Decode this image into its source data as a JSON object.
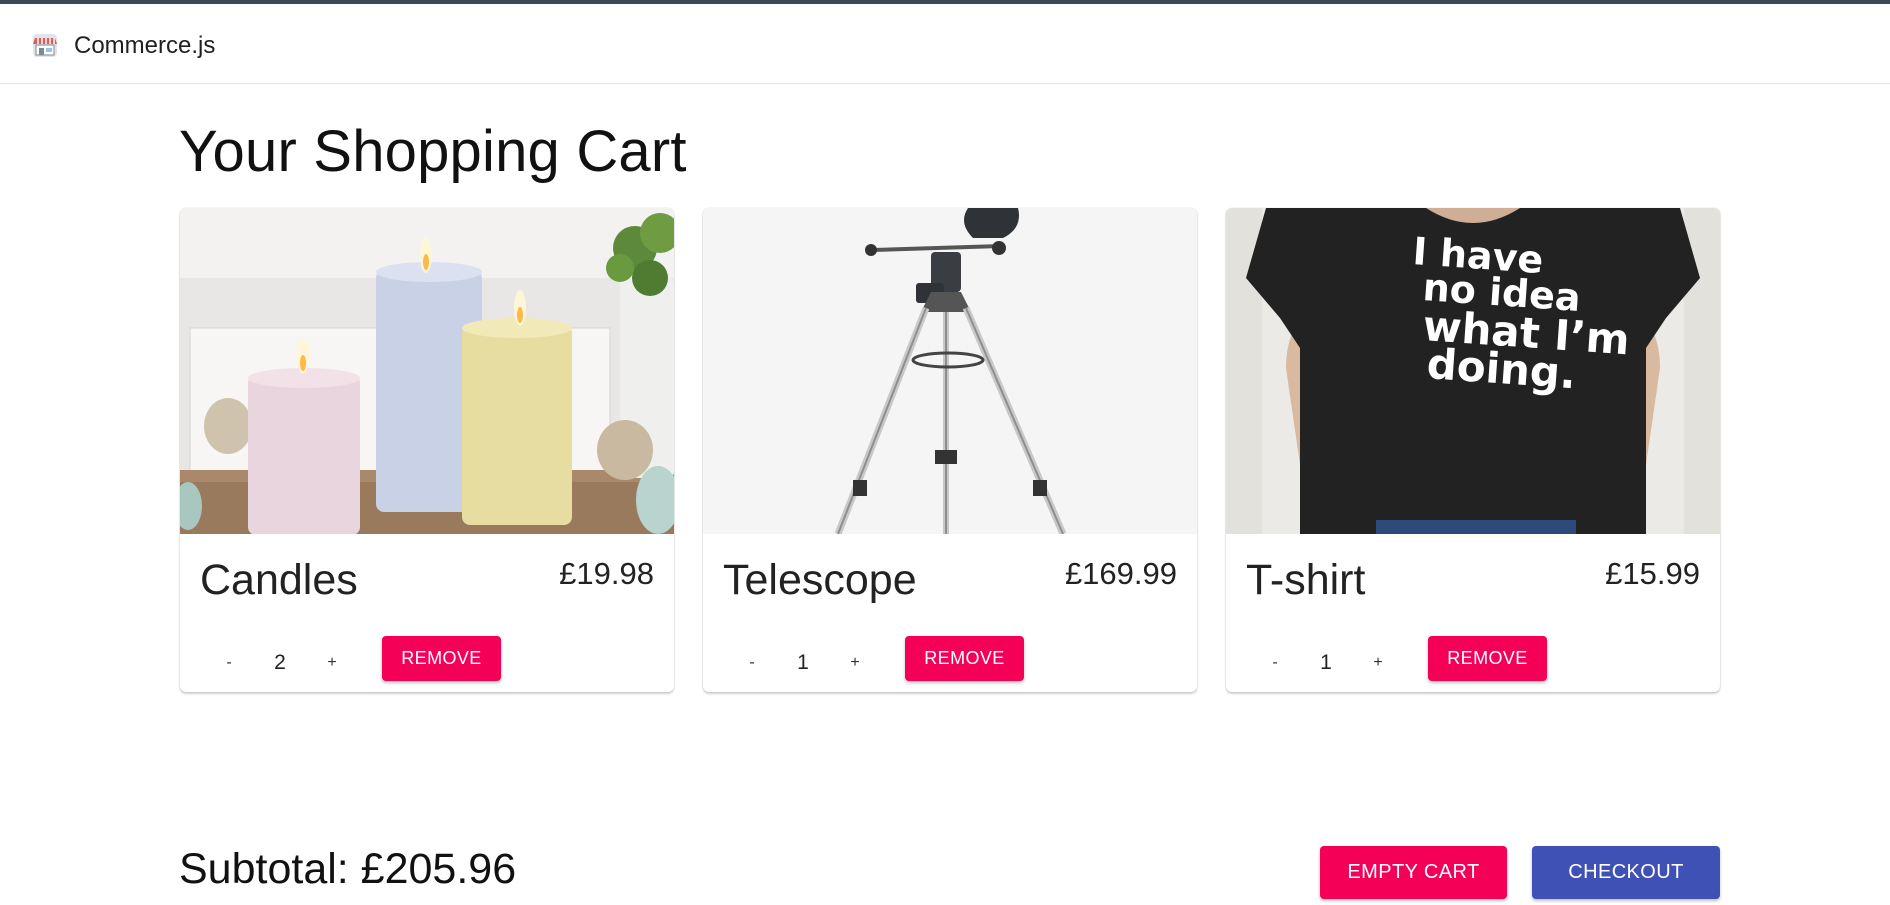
{
  "app": {
    "brand": "Commerce.js",
    "logo_icon": "storefront-icon"
  },
  "page": {
    "title": "Your Shopping Cart"
  },
  "cart": {
    "items": [
      {
        "name": "Candles",
        "price": "£19.98",
        "quantity": "2",
        "minus_label": "-",
        "plus_label": "+",
        "remove_label": "REMOVE",
        "image_icon": "candles-image"
      },
      {
        "name": "Telescope",
        "price": "£169.99",
        "quantity": "1",
        "minus_label": "-",
        "plus_label": "+",
        "remove_label": "REMOVE",
        "image_icon": "telescope-image"
      },
      {
        "name": "T-shirt",
        "price": "£15.99",
        "quantity": "1",
        "minus_label": "-",
        "plus_label": "+",
        "remove_label": "REMOVE",
        "image_icon": "tshirt-image",
        "shirt_print": [
          "I have",
          "no idea",
          "what I’m",
          "doing."
        ]
      }
    ],
    "subtotal": "Subtotal: £205.96",
    "empty_label": "EMPTY CART",
    "checkout_label": "CHECKOUT"
  },
  "colors": {
    "accent_pink": "#f50057",
    "primary_indigo": "#3f51b5"
  }
}
